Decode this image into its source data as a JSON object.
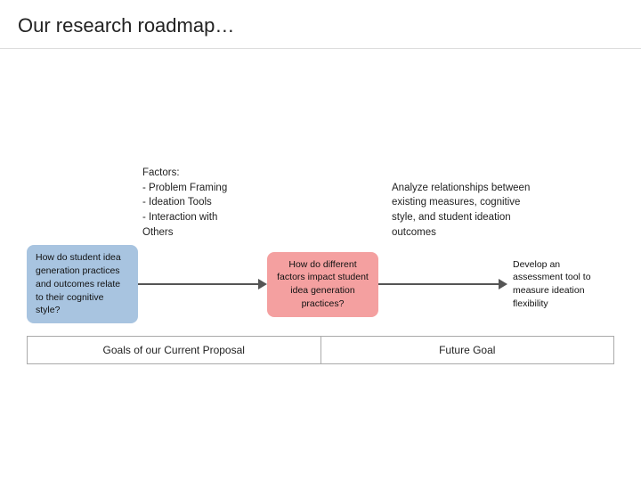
{
  "header": {
    "title": "Our research roadmap…"
  },
  "roadmap": {
    "factors_label": "Factors:\n- Problem Framing\n- Ideation Tools\n- Interaction with Others",
    "analyze_label": "Analyze relationships between existing measures, cognitive style, and student ideation outcomes",
    "box_blue_text": "How do student idea generation practices and outcomes relate to their cognitive style?",
    "box_pink_text": "How do different factors impact student idea generation practices?",
    "box_future_text": "Develop an assessment tool to measure ideation flexibility",
    "bottom_left_label": "Goals of our Current Proposal",
    "bottom_right_label": "Future Goal"
  }
}
